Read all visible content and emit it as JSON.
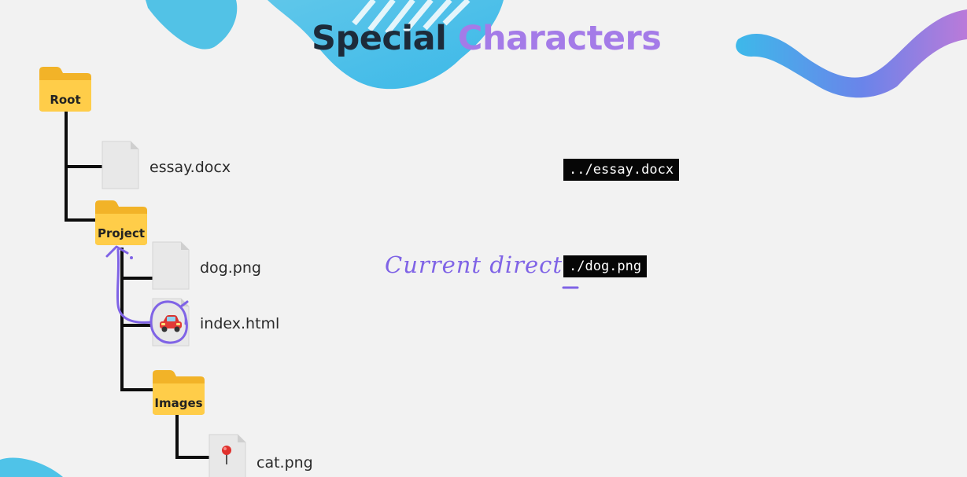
{
  "slide": {
    "title_part1": "Special",
    "title_part2": "Characters",
    "accent_color": "#a47be8",
    "title_color": "#1d2b3a"
  },
  "tree": {
    "root": {
      "label": "Root",
      "icon": "folder-icon"
    },
    "essay": {
      "label": "essay.docx",
      "icon": "document-icon"
    },
    "project": {
      "label": "Project",
      "icon": "folder-icon"
    },
    "dog": {
      "label": "dog.png",
      "icon": "document-icon"
    },
    "index": {
      "label": "index.html",
      "icon": "car-icon"
    },
    "images": {
      "label": "Images",
      "icon": "folder-icon"
    },
    "cat": {
      "label": "cat.png",
      "icon": "pin-icon"
    }
  },
  "paths": {
    "parent_path": "../essay.docx",
    "current_path": "./dog.png"
  },
  "annotation": {
    "handwritten_note": "Current director"
  }
}
